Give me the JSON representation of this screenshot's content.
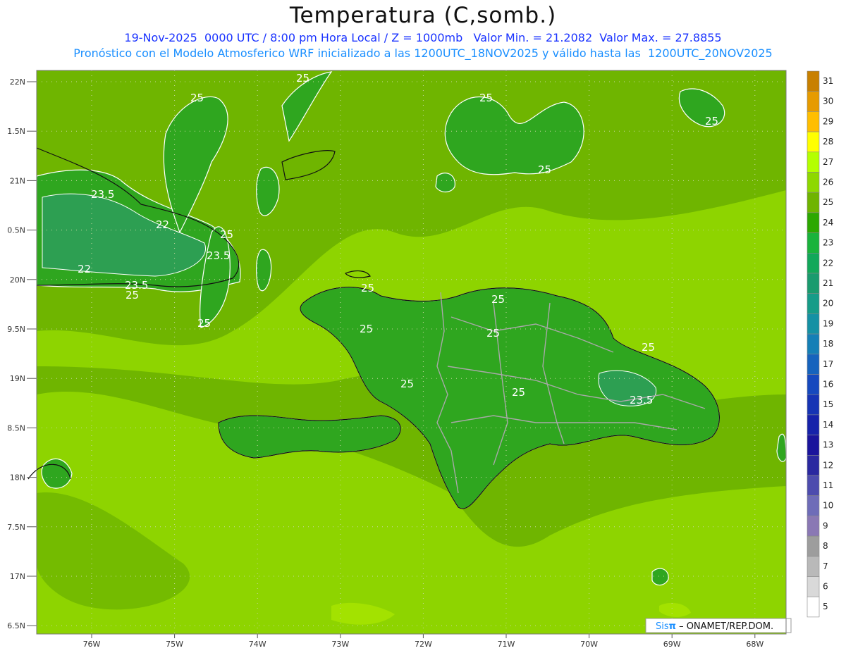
{
  "title": "Temperatura (C,somb.)",
  "subtitle_line1": "19-Nov-2025  0000 UTC / 8:00 pm Hora Local / Z = 1000mb   Valor Min. = 21.2082  Valor Max. = 27.8855",
  "subtitle_line2": "Pronóstico con el Modelo Atmosferico WRF inicializado a las 1200UTC_18NOV2025 y válido hasta las  1200UTC_20NOV2025",
  "credit": {
    "prefix": "Sis",
    "pi": "π",
    "rest": " – ONAMET/REP.DOM."
  },
  "lat_labels": [
    "22N",
    "1.5N",
    "21N",
    "0.5N",
    "20N",
    "9.5N",
    "19N",
    "8.5N",
    "18N",
    "7.5N",
    "17N",
    "6.5N"
  ],
  "lon_labels": [
    "76W",
    "75W",
    "74W",
    "73W",
    "72W",
    "71W",
    "70W",
    "69W",
    "68W"
  ],
  "contour_labels": [
    "25",
    "25",
    "25",
    "25",
    "25",
    "25",
    "25",
    "25",
    "25",
    "25",
    "25",
    "25",
    "25",
    "25",
    "25",
    "23.5",
    "23.5",
    "23.5",
    "23.5",
    "22",
    "22"
  ],
  "colorbar": {
    "labels": [
      "31",
      "30",
      "29",
      "28",
      "27",
      "26",
      "25",
      "24",
      "23",
      "22",
      "21",
      "20",
      "19",
      "18",
      "17",
      "16",
      "15",
      "14",
      "13",
      "12",
      "11",
      "10",
      "9",
      "8",
      "7",
      "6",
      "5"
    ],
    "colors": [
      "#c88000",
      "#e69b00",
      "#ffbe00",
      "#ffff00",
      "#b4ff00",
      "#8ed800",
      "#6fb400",
      "#2ca800",
      "#1ab33c",
      "#12a85a",
      "#1a9b6e",
      "#169c88",
      "#1591a4",
      "#157fb6",
      "#1663bd",
      "#1649be",
      "#1634b4",
      "#1622aa",
      "#1a149c",
      "#2a28a0",
      "#4d4cae",
      "#6e6cb8",
      "#8a78b4",
      "#9d9d9d",
      "#b9b9b9",
      "#d9d9d9",
      "#ffffff"
    ]
  },
  "colors": {
    "land_green": "#2fa61f",
    "zone_23": "#31a44a",
    "sea_24": "#6fb500",
    "sea_25": "#8ed400",
    "sea_26": "#a5e400",
    "grid": "#c7d7a0"
  }
}
